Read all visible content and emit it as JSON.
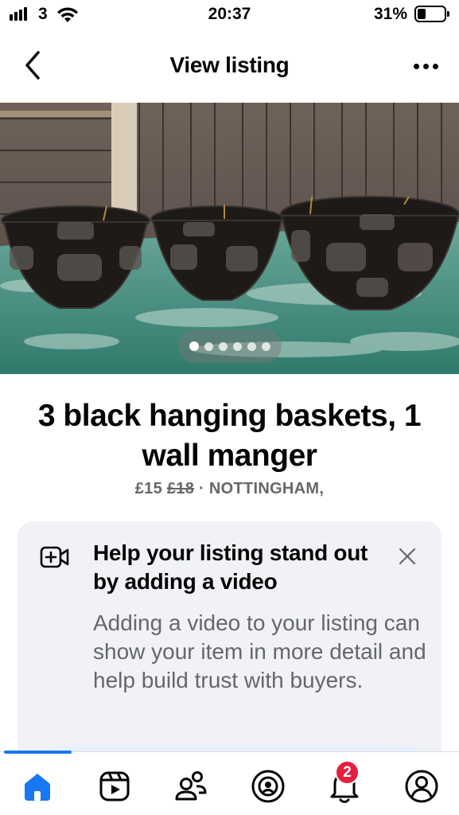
{
  "status_bar": {
    "carrier": "3",
    "time": "20:37",
    "battery": "31%",
    "battery_level": 0.31
  },
  "nav": {
    "title": "View listing",
    "back_icon": "chevron-left-icon",
    "more_icon": "more-horizontal-icon"
  },
  "photo": {
    "image_count": 6,
    "active_index": 0
  },
  "listing": {
    "title": "3 black hanging baskets, 1 wall manger",
    "price": "£15",
    "original_price": "£18",
    "separator": " · ",
    "location": "NOTTINGHAM,"
  },
  "tip_card": {
    "icon": "video-add-icon",
    "title": "Help your listing stand out by adding a video",
    "body": "Adding a video to your listing can show your item in more detail and help build trust with buyers.",
    "close_icon": "close-icon"
  },
  "tabbar": {
    "tabs": [
      {
        "name": "home",
        "icon": "home-icon",
        "active": true
      },
      {
        "name": "video",
        "icon": "video-play-icon",
        "active": false
      },
      {
        "name": "friends",
        "icon": "friends-icon",
        "active": false
      },
      {
        "name": "profile",
        "icon": "profile-circle-icon",
        "active": false
      },
      {
        "name": "notifications",
        "icon": "bell-icon",
        "active": false
      },
      {
        "name": "menu",
        "icon": "avatar-icon",
        "active": false
      }
    ],
    "notifications_badge": "2"
  },
  "colors": {
    "accent": "#1877f2",
    "badge": "#e41e3f",
    "secondary_text": "#65676b",
    "card_bg": "#f0f2f5"
  }
}
